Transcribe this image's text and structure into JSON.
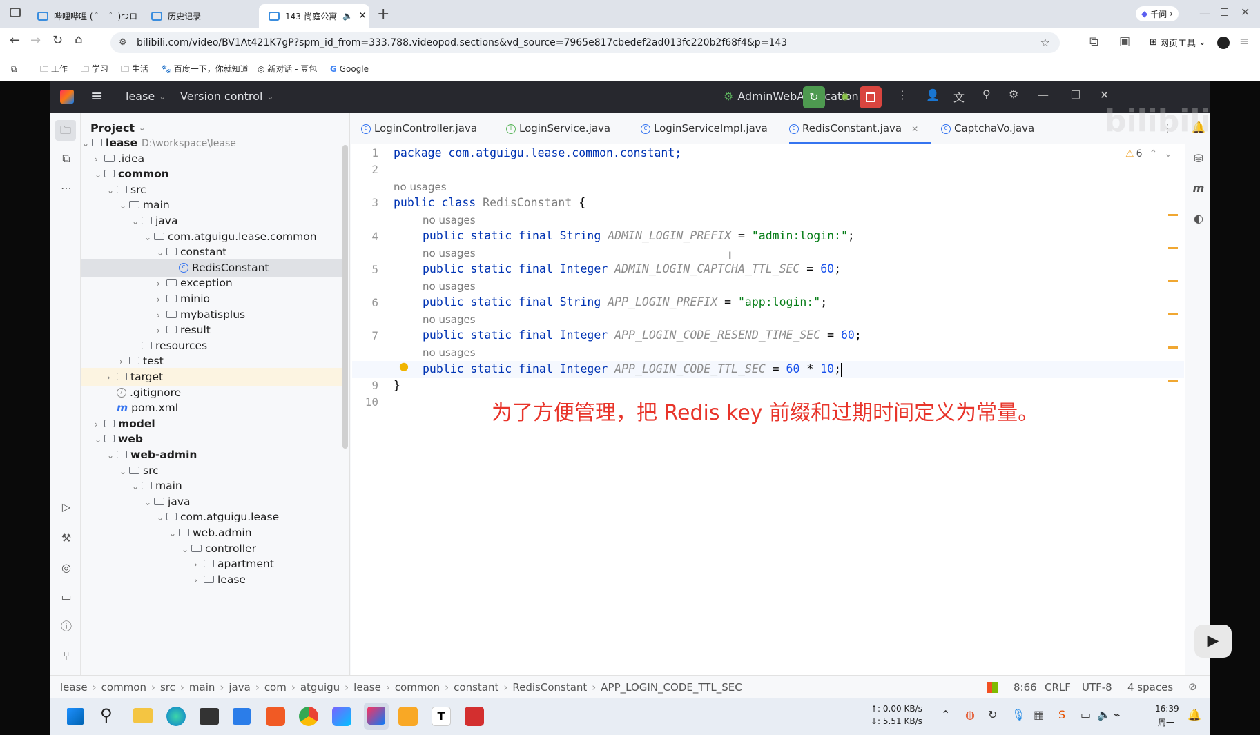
{
  "browser": {
    "tabs": [
      {
        "label": "哔哩哔哩 ( ゜- ゜)つロ"
      },
      {
        "label": "历史记录"
      },
      {
        "label": "143-尚庭公寓"
      }
    ],
    "url": "bilibili.com/video/BV1At421K7gP?spm_id_from=333.788.videopod.sections&vd_source=7965e817cbedef2ad013fc220b2f68f4&p=143",
    "qianwen": "千问",
    "web_tools": "网页工具",
    "bookmarks": [
      "工作",
      "学习",
      "生活",
      "百度一下，你就知道",
      "新对话 - 豆包",
      "Google"
    ]
  },
  "ide": {
    "project_name": "lease",
    "vcs": "Version control",
    "run_config": "AdminWebApplication",
    "panel_title": "Project",
    "tree": [
      {
        "label": "lease",
        "extra": "D:\\workspace\\lease",
        "bold": true
      },
      {
        "label": ".idea"
      },
      {
        "label": "common",
        "bold": true
      },
      {
        "label": "src"
      },
      {
        "label": "main"
      },
      {
        "label": "java"
      },
      {
        "label": "com.atguigu.lease.common"
      },
      {
        "label": "constant"
      },
      {
        "label": "RedisConstant"
      },
      {
        "label": "exception"
      },
      {
        "label": "minio"
      },
      {
        "label": "mybatisplus"
      },
      {
        "label": "result"
      },
      {
        "label": "resources"
      },
      {
        "label": "test"
      },
      {
        "label": "target"
      },
      {
        "label": ".gitignore"
      },
      {
        "label": "pom.xml"
      },
      {
        "label": "model",
        "bold": true
      },
      {
        "label": "web",
        "bold": true
      },
      {
        "label": "web-admin",
        "bold": true
      },
      {
        "label": "src"
      },
      {
        "label": "main"
      },
      {
        "label": "java"
      },
      {
        "label": "com.atguigu.lease"
      },
      {
        "label": "web.admin"
      },
      {
        "label": "controller"
      },
      {
        "label": "apartment"
      },
      {
        "label": "lease"
      }
    ],
    "editor_tabs": [
      "LoginController.java",
      "LoginService.java",
      "LoginServiceImpl.java",
      "RedisConstant.java",
      "CaptchaVo.java"
    ],
    "warnings": "6",
    "no_usages": "no usages",
    "code": {
      "l1": "package com.atguigu.lease.common.constant;",
      "l3a": "public class ",
      "l3b": "RedisConstant",
      "l3c": " {",
      "l4a": "public static final String ",
      "l4b": "ADMIN_LOGIN_PREFIX",
      "l4c": " = ",
      "l4d": "\"admin:login:\"",
      "l4e": ";",
      "l5a": "public static final Integer ",
      "l5b": "ADMIN_LOGIN_CAPTCHA_TTL_SEC",
      "l5c": " = ",
      "l5d": "60",
      "l5e": ";",
      "l6a": "public static final String ",
      "l6b": "APP_LOGIN_PREFIX",
      "l6c": " = ",
      "l6d": "\"app:login:\"",
      "l6e": ";",
      "l7a": "public static final Integer ",
      "l7b": "APP_LOGIN_CODE_RESEND_TIME_SEC",
      "l7c": " = ",
      "l7d": "60",
      "l7e": ";",
      "l8a": "public static final Integer ",
      "l8b": "APP_LOGIN_CODE_TTL_SEC",
      "l8c": " = ",
      "l8d": "60",
      "l8e": " * ",
      "l8f": "10",
      "l8g": ";",
      "l9": "}"
    },
    "subtitle": "为了方便管理，把 Redis key 前缀和过期时间定义为常量。",
    "breadcrumb": [
      "lease",
      "common",
      "src",
      "main",
      "java",
      "com",
      "atguigu",
      "lease",
      "common",
      "constant",
      "RedisConstant",
      "APP_LOGIN_CODE_TTL_SEC"
    ],
    "status": {
      "position": "8:66",
      "line_sep": "CRLF",
      "encoding": "UTF-8",
      "indent": "4 spaces"
    }
  },
  "taskbar": {
    "net_up": "↑: 0.00 KB/s",
    "net_down": "↓: 5.51 KB/s",
    "time": "16:39",
    "day": "周一"
  }
}
